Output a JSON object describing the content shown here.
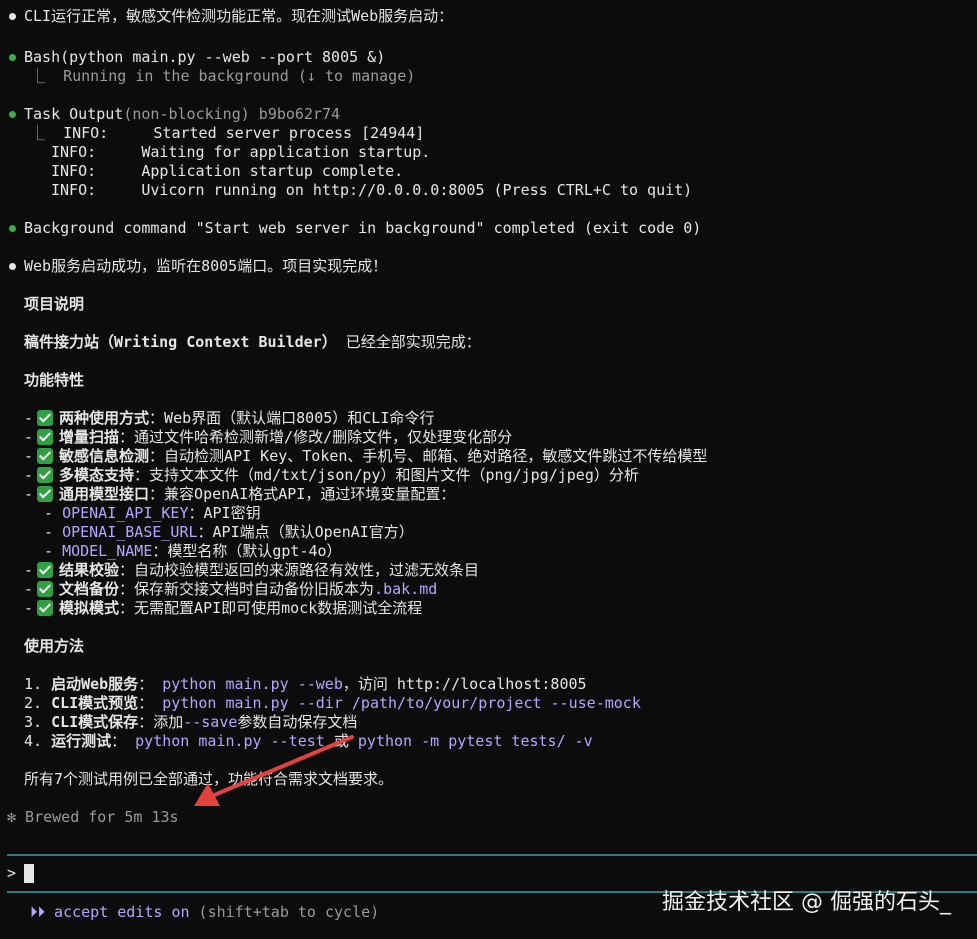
{
  "msg1": "CLI运行正常，敏感文件检测功能正常。现在测试Web服务启动：",
  "bash": {
    "tool": "Bash",
    "args": "(python main.py --web --port 8005 &)",
    "sub": "Running in the background (↓ to manage)"
  },
  "task": {
    "tool": "Task Output",
    "args": "(non-blocking) b9bo62r74",
    "logs": [
      {
        "level": "INFO:",
        "text": "Started server process [24944]"
      },
      {
        "level": "INFO:",
        "text": "Waiting for application startup."
      },
      {
        "level": "INFO:",
        "text": "Application startup complete."
      },
      {
        "level": "INFO:",
        "text": "Uvicorn running on http://0.0.0.0:8005 (Press CTRL+C to quit)"
      }
    ]
  },
  "bg": "Background command \"Start web server in background\" completed (exit code 0)",
  "msg2": "Web服务启动成功，监听在8005端口。项目实现完成！",
  "h1": "项目说明",
  "p1_bold": "稿件接力站（Writing Context Builder）",
  "p1_rest": "已经全部实现完成：",
  "h2": "功能特性",
  "f1": {
    "t": "两种使用方式",
    "d": "：Web界面（默认端口8005）和CLI命令行"
  },
  "f2": {
    "t": "增量扫描",
    "d": "：通过文件哈希检测新增/修改/删除文件，仅处理变化部分"
  },
  "f3": {
    "t": "敏感信息检测",
    "d": "：自动检测API Key、Token、手机号、邮箱、绝对路径，敏感文件跳过不传给模型"
  },
  "f4": {
    "t": "多模态支持",
    "d": "：支持文本文件（md/txt/json/py）和图片文件（png/jpg/jpeg）分析"
  },
  "f5": {
    "t": "通用模型接口",
    "d": "：兼容OpenAI格式API，通过环境变量配置："
  },
  "s1": {
    "k": "OPENAI_API_KEY",
    "d": "：API密钥"
  },
  "s2": {
    "k": "OPENAI_BASE_URL",
    "d": "：API端点（默认OpenAI官方）"
  },
  "s3": {
    "k": "MODEL_NAME",
    "d": "：模型名称（默认gpt-4o）"
  },
  "f6": {
    "t": "结果校验",
    "d": "：自动校验模型返回的来源路径有效性，过滤无效条目"
  },
  "f7": {
    "t": "文档备份",
    "d": "：保存新交接文档时自动备份旧版本为",
    "k": ".bak.md"
  },
  "f8": {
    "t": "模拟模式",
    "d": "：无需配置API即可使用mock数据测试全流程"
  },
  "h3": "使用方法",
  "u1": {
    "n": "1.",
    "t": "启动Web服务",
    "sep": "：",
    "c": "python main.py --web",
    "d": "，访问 http://localhost:8005"
  },
  "u2": {
    "n": "2.",
    "t": "CLI模式预览",
    "sep": "：",
    "c": "python main.py --dir /path/to/your/project --use-mock"
  },
  "u3": {
    "n": "3.",
    "t": "CLI模式保存",
    "sep": "：",
    "d1": "添加",
    "c": "--save",
    "d2": "参数自动保存文档"
  },
  "u4": {
    "n": "4.",
    "t": "运行测试",
    "sep": "：",
    "c1": "python main.py --test",
    "or": "或",
    "c2": "python -m pytest tests/ -v"
  },
  "final": "所有7个测试用例已全部通过，功能符合需求文档要求。",
  "brewed": "✻ Brewed for 5m 13s",
  "prompt": ">",
  "mode": {
    "arrows": "⏵⏵",
    "label": "accept edits on",
    "hint": "(shift+tab to cycle)"
  },
  "watermark": "掘金技术社区 @ 倔强的石头_",
  "colors": {
    "accent": "#b7a5ff",
    "green": "#3fae4a",
    "rule": "#2f7d7a",
    "arrow": "#e2433f"
  }
}
